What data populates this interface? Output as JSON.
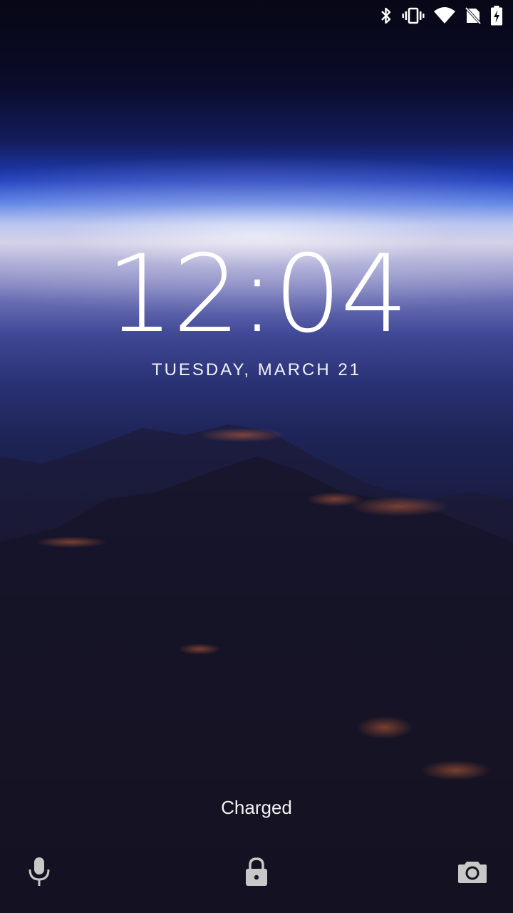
{
  "status_bar": {
    "icons": [
      "bluetooth-icon",
      "vibrate-icon",
      "wifi-icon",
      "no-sim-icon",
      "battery-charging-icon"
    ]
  },
  "lock_screen": {
    "time": "12:04",
    "date": "TUESDAY, MARCH 21",
    "charging_status": "Charged"
  },
  "bottom_actions": {
    "left": "microphone-icon",
    "center": "lock-icon",
    "right": "camera-icon"
  },
  "colors": {
    "text": "#ffffff",
    "icon_gray": "#c8c8c8",
    "horizon_blue": "#4c78e6"
  }
}
